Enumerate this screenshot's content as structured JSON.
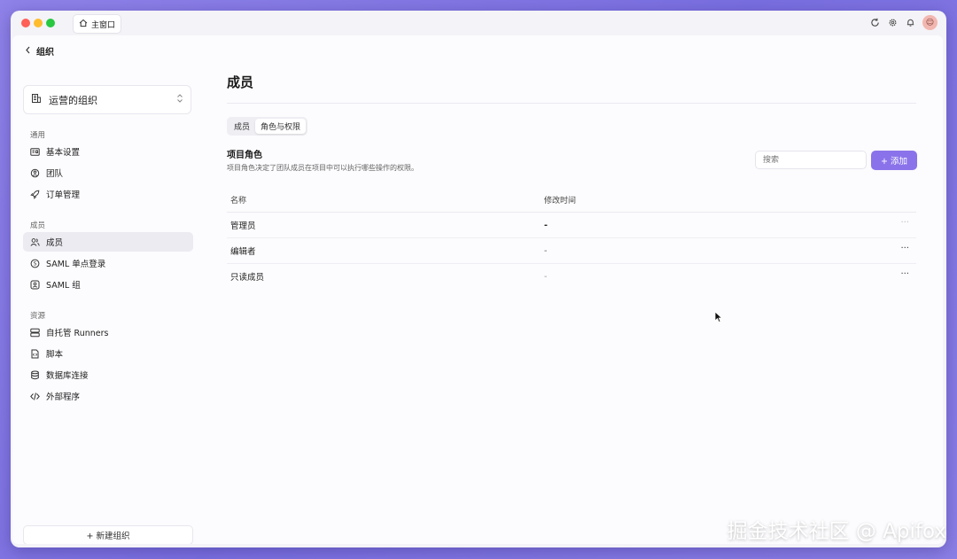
{
  "titlebar": {
    "home_tab_label": "主窗口",
    "icons": [
      "refresh-icon",
      "settings-icon",
      "bell-icon"
    ],
    "avatar_initial": "☺"
  },
  "sidebar": {
    "back_label": "组织",
    "org_name": "运营的组织",
    "sections": [
      {
        "title": "通用",
        "items": [
          {
            "label": "基本设置",
            "icon": "id-card-icon"
          },
          {
            "label": "团队",
            "icon": "team-icon"
          },
          {
            "label": "订单管理",
            "icon": "rocket-icon"
          }
        ]
      },
      {
        "title": "成员",
        "items": [
          {
            "label": "成员",
            "icon": "users-icon",
            "active": true
          },
          {
            "label": "SAML 单点登录",
            "icon": "saml-icon"
          },
          {
            "label": "SAML 组",
            "icon": "saml-group-icon"
          }
        ]
      },
      {
        "title": "资源",
        "items": [
          {
            "label": "自托管 Runners",
            "icon": "server-icon"
          },
          {
            "label": "脚本",
            "icon": "script-icon"
          },
          {
            "label": "数据库连接",
            "icon": "database-icon"
          },
          {
            "label": "外部程序",
            "icon": "code-icon"
          }
        ]
      }
    ],
    "new_org_label": "+ 新建组织"
  },
  "main": {
    "title": "成员",
    "tabs": [
      {
        "label": "成员",
        "active": false
      },
      {
        "label": "角色与权限",
        "active": true
      }
    ],
    "section_title": "项目角色",
    "section_desc": "项目角色决定了团队成员在项目中可以执行哪些操作的权限。",
    "search_placeholder": "搜索",
    "add_label": "+ 添加",
    "table": {
      "headers": [
        "名称",
        "修改时间"
      ],
      "rows": [
        {
          "name": "管理员",
          "time": "-",
          "more": "···"
        },
        {
          "name": "编辑者",
          "time": "-",
          "more": "···"
        },
        {
          "name": "只读成员",
          "time": "-",
          "more": "···"
        }
      ]
    }
  },
  "watermark": "掘金技术社区 @ Apifox",
  "colors": {
    "accent": "#8a73ea",
    "background": "#8f82e8",
    "active_nav": "#ecebf1"
  }
}
